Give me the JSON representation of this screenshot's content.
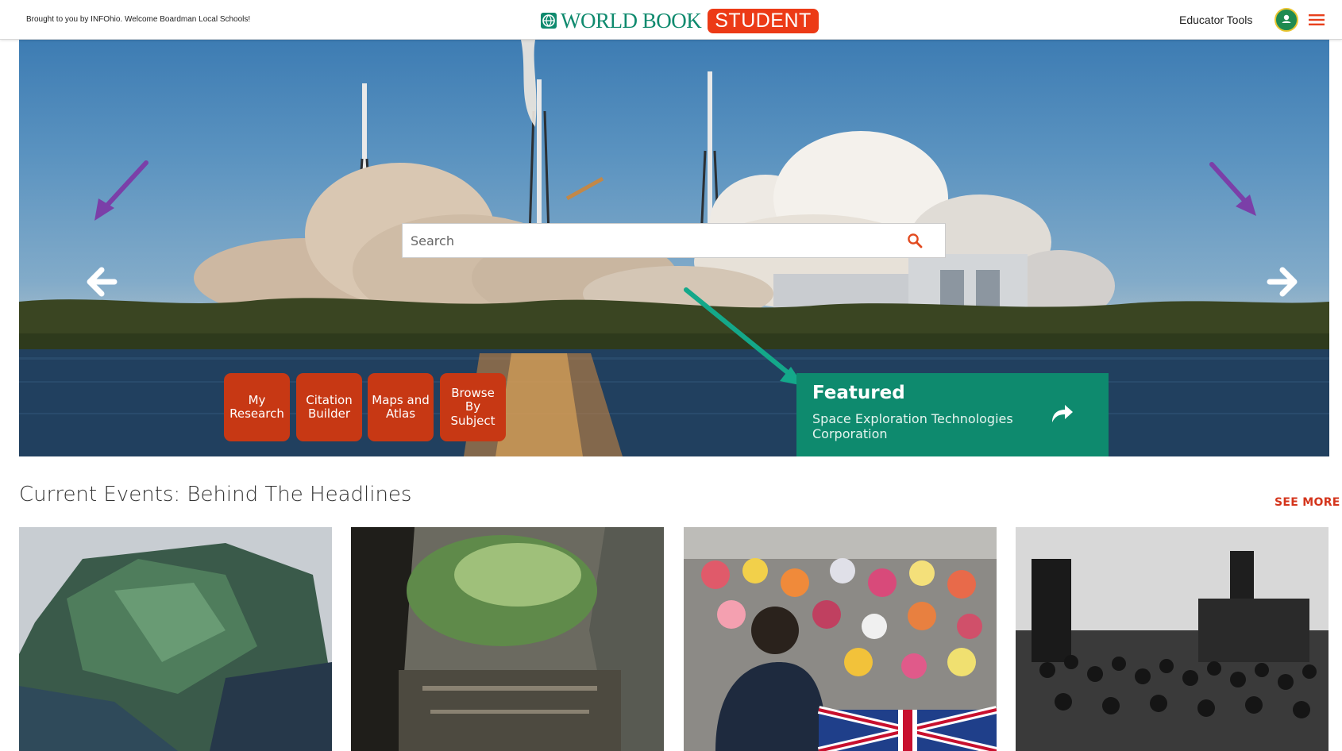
{
  "topbar": {
    "brought_by": "Brought to you by INFOhio. Welcome Boardman Local Schools!",
    "logo_main": "WORLD BOOK",
    "logo_badge": "STUDENT",
    "educator_tools": "Educator Tools"
  },
  "search": {
    "placeholder": "Search"
  },
  "tools": [
    {
      "label": "My Research"
    },
    {
      "label": "Citation Builder"
    },
    {
      "label": "Maps and Atlas"
    },
    {
      "label": "Browse By Subject"
    }
  ],
  "featured": {
    "title": "Featured",
    "subtitle": "Space Exploration Technologies Corporation"
  },
  "current_events": {
    "title": "Current Events: Behind The Headlines",
    "see_more": "SEE MORE"
  },
  "colors": {
    "brand_green": "#0f8a6e",
    "brand_red": "#ec3a16",
    "tile_red": "#c73814",
    "featured_green": "#0e8a6e",
    "see_more_red": "#d4351c"
  }
}
